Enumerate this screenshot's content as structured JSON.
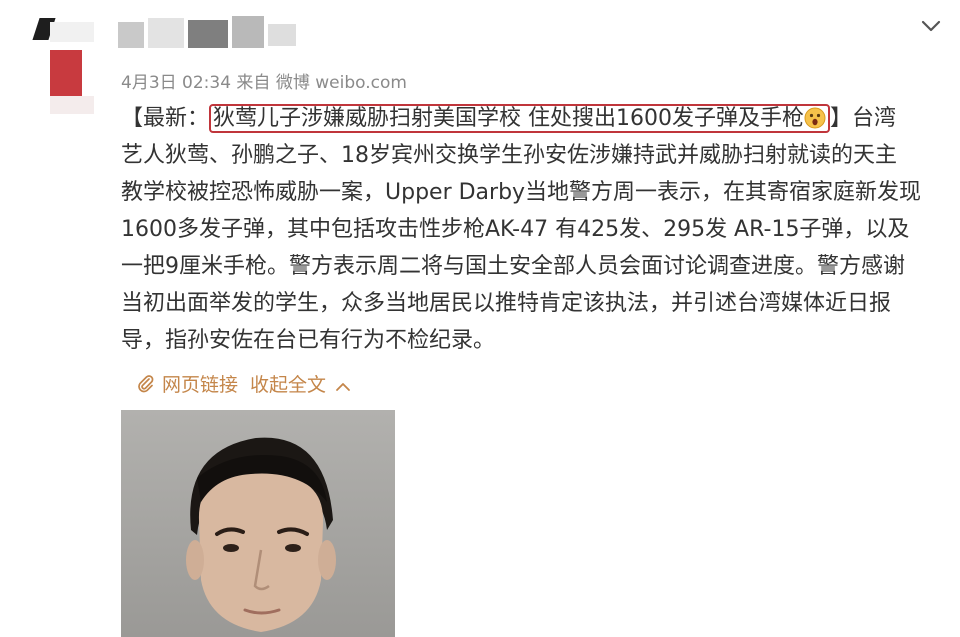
{
  "header": {
    "meta": "4月3日 02:34 来自 微博 weibo.com"
  },
  "post": {
    "topic_prefix": "【最新：",
    "headline": "狄莺儿子涉嫌威胁扫射美国学校 住处搜出1600发子弹及手枪",
    "line1_tail": "】台湾",
    "body_lines": [
      "艺人狄莺、孙鹏之子、18岁宾州交换学生孙安佐涉嫌持武并威胁扫射就读的天主",
      "教学校被控恐怖威胁一案，Upper Darby当地警方周一表示，在其寄宿家庭新发现",
      "1600多发子弹，其中包括攻击性步枪AK-47 有425发、295发 AR-15子弹，以及",
      "一把9厘米手枪。警方表示周二将与国土安全部人员会面讨论调查进度。警方感谢",
      "当初出面举发的学生，众多当地居民以推特肯定该执法，并引述台湾媒体近日报",
      "导，指孙安佐在台已有行为不检纪录。"
    ]
  },
  "links": {
    "webpage": "网页链接",
    "collapse": "收起全文"
  },
  "icons": {
    "menu": "chevron-down-icon",
    "clip": "paperclip-icon",
    "collapse": "chevron-up-icon",
    "emoji": "surprised-emoji-icon"
  },
  "colors": {
    "link": "#c4864a",
    "highlight_border": "#c0353b",
    "meta_text": "#8a8a8a",
    "body_text": "#333333"
  }
}
